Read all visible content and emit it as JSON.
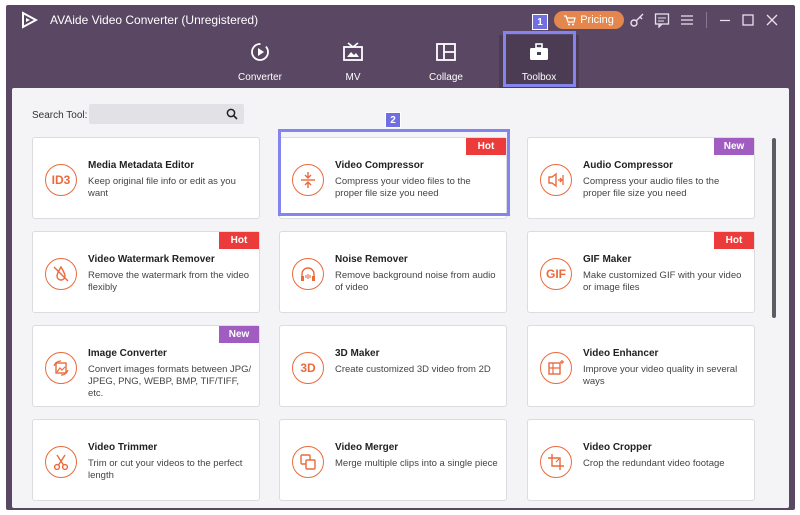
{
  "window": {
    "title": "AVAide Video Converter (Unregistered)",
    "pricing_label": "Pricing"
  },
  "nav": {
    "tabs": [
      {
        "label": "Converter"
      },
      {
        "label": "MV"
      },
      {
        "label": "Collage"
      },
      {
        "label": "Toolbox"
      }
    ],
    "active_tab": "Toolbox"
  },
  "markers": [
    "1",
    "2"
  ],
  "search": {
    "label": "Search Tool:",
    "placeholder": ""
  },
  "tools": [
    {
      "title": "Media Metadata Editor",
      "desc": "Keep original file info or edit as you want",
      "icon": "id3-icon",
      "glyph": "ID3",
      "badge": ""
    },
    {
      "title": "Video Compressor",
      "desc": "Compress your video files to the proper file size you need",
      "icon": "compress-icon",
      "glyph": "",
      "badge": "Hot"
    },
    {
      "title": "Audio Compressor",
      "desc": "Compress your audio files to the proper file size you need",
      "icon": "audio-compress-icon",
      "glyph": "",
      "badge": "New"
    },
    {
      "title": "Video Watermark Remover",
      "desc": "Remove the watermark from the video flexibly",
      "icon": "watermark-remove-icon",
      "glyph": "",
      "badge": "Hot"
    },
    {
      "title": "Noise Remover",
      "desc": "Remove background noise from audio of video",
      "icon": "headphones-icon",
      "glyph": "",
      "badge": ""
    },
    {
      "title": "GIF Maker",
      "desc": "Make customized GIF with your video or image files",
      "icon": "gif-icon",
      "glyph": "GIF",
      "badge": "Hot"
    },
    {
      "title": "Image Converter",
      "desc": "Convert images formats between JPG/ JPEG, PNG, WEBP, BMP, TIF/TIFF, etc.",
      "icon": "image-convert-icon",
      "glyph": "",
      "badge": "New"
    },
    {
      "title": "3D Maker",
      "desc": "Create customized 3D video from 2D",
      "icon": "3d-icon",
      "glyph": "3D",
      "badge": ""
    },
    {
      "title": "Video Enhancer",
      "desc": "Improve your video quality in several ways",
      "icon": "enhance-icon",
      "glyph": "",
      "badge": ""
    },
    {
      "title": "Video Trimmer",
      "desc": "Trim or cut your videos to the perfect length",
      "icon": "scissors-icon",
      "glyph": "",
      "badge": ""
    },
    {
      "title": "Video Merger",
      "desc": "Merge multiple clips into a single piece",
      "icon": "merge-icon",
      "glyph": "",
      "badge": ""
    },
    {
      "title": "Video Cropper",
      "desc": "Crop the redundant video footage",
      "icon": "crop-icon",
      "glyph": "",
      "badge": ""
    }
  ],
  "colors": {
    "titlebar": "#5a4763",
    "accent": "#ea6a3c",
    "hot": "#ec3b3b",
    "new": "#a05cc0",
    "highlight": "#8484ee"
  }
}
